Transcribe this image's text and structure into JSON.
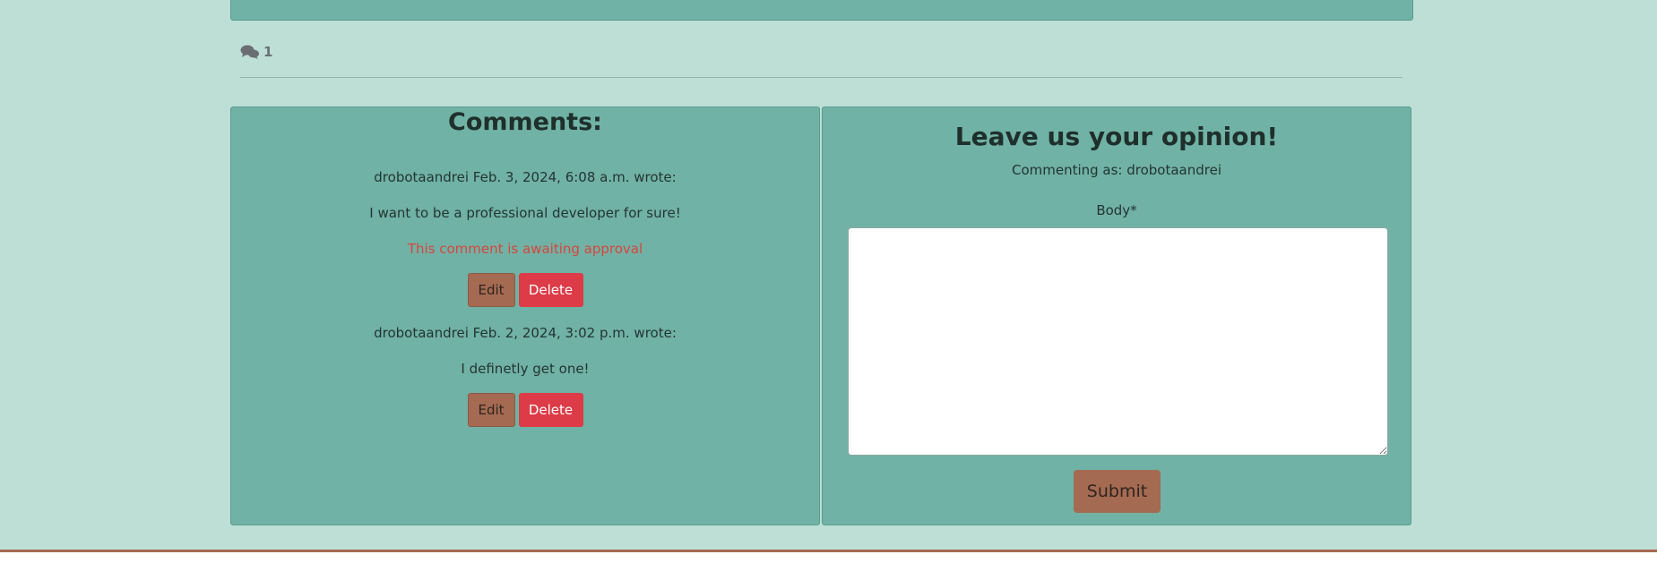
{
  "post": {
    "comment_count": "1"
  },
  "comments_panel": {
    "heading": "Comments:",
    "comments": [
      {
        "byline": "drobotaandrei Feb. 3, 2024, 6:08 a.m. wrote:",
        "body": "I want to be a professional developer for sure!",
        "status": "This comment is awaiting approval",
        "edit_label": "Edit",
        "delete_label": "Delete"
      },
      {
        "byline": "drobotaandrei Feb. 2, 2024, 3:02 p.m. wrote:",
        "body": "I definetly get one!",
        "edit_label": "Edit",
        "delete_label": "Delete"
      }
    ]
  },
  "comment_form": {
    "heading": "Leave us your opinion!",
    "commenting_as": "Commenting as: drobotaandrei",
    "body_label": "Body*",
    "body_value": "",
    "submit_label": "Submit"
  },
  "icons": {
    "comment_count": "comments-icon"
  },
  "colors": {
    "page_background": "#bddfd6",
    "panel_background": "#70b2a5",
    "accent_brown": "#a56a52",
    "delete_red": "#dc3b47",
    "awaiting_red": "#d9453e"
  }
}
